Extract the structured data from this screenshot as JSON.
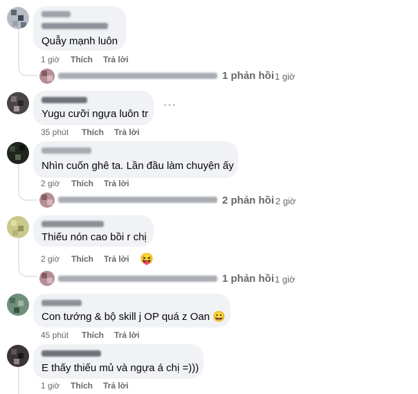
{
  "comments": [
    {
      "text": "Quẫy mạnh luôn",
      "time": "1 giờ",
      "like": "Thích",
      "reply": "Trả lời"
    },
    {
      "text": "Yugu cưỡi ngựa luôn tr",
      "time": "35 phút",
      "like": "Thích",
      "reply": "Trả lời",
      "more": "···"
    },
    {
      "text": "Nhìn cuốn ghê ta. Lần đầu làm chuyện ấy",
      "time": "2 giờ",
      "like": "Thích",
      "reply": "Trả lời"
    },
    {
      "text": "Thiếu nón cao bồi r chị",
      "time": "2 giờ",
      "like": "Thích",
      "reply": "Trả lời",
      "reaction": "😝"
    },
    {
      "text": "Con tướng & bộ skill j OP quá z Oan 😀",
      "time": "45 phút",
      "like": "Thích",
      "reply": "Trả lời"
    },
    {
      "text": "E thấy thiếu mủ và ngựa á chị =)))",
      "time": "1 giờ",
      "like": "Thích",
      "reply": "Trả lời"
    }
  ],
  "reply_summaries": [
    {
      "label": "1 phản hồi",
      "time": "1 giờ"
    },
    {
      "label": "2 phản hồi",
      "time": "2 giờ"
    },
    {
      "label": "1 phản hồi",
      "time": "1 giờ"
    }
  ],
  "colors": {
    "bubble": "#f0f2f5",
    "meta": "#65676b",
    "thread": "#e4e6eb"
  }
}
